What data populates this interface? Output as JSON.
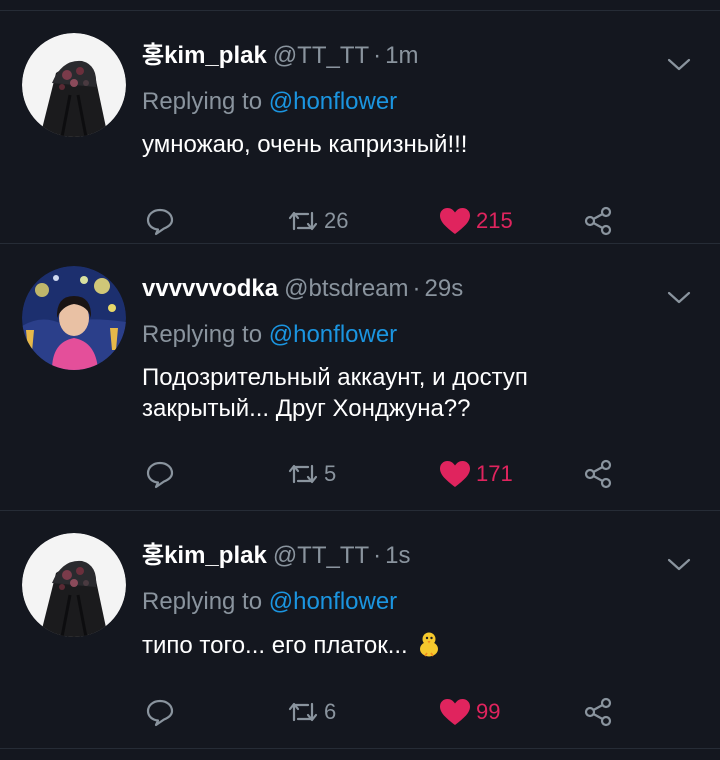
{
  "tweets": [
    {
      "name": "홍kim_plak",
      "handle": "@TT_TT",
      "time": "1m",
      "replying_prefix": "Replying to",
      "replying_to": "@honflower",
      "text": "умножаю, очень капризный!!!",
      "retweets": "26",
      "likes": "215",
      "avatar_icon": "bouquet-avatar"
    },
    {
      "name": "vvvvvvodka",
      "handle": "@btsdream",
      "time": "29s",
      "replying_prefix": "Replying to",
      "replying_to": "@honflower",
      "text": "Подозрительный аккаунт, и доступ закрытый... Друг Хонджуна??",
      "retweets": "5",
      "likes": "171",
      "avatar_icon": "starry-night-portrait-avatar"
    },
    {
      "name": "홍kim_plak",
      "handle": "@TT_TT",
      "time": "1s",
      "replying_prefix": "Replying to",
      "replying_to": "@honflower",
      "text": "типо того... его платок...",
      "retweets": "6",
      "likes": "99",
      "avatar_icon": "bouquet-avatar",
      "emoji": "chick-emoji"
    }
  ],
  "colors": {
    "background": "#14171f",
    "secondary_text": "#8a949e",
    "link": "#1b95e0",
    "like": "#e0245e",
    "divider": "#262c36"
  }
}
